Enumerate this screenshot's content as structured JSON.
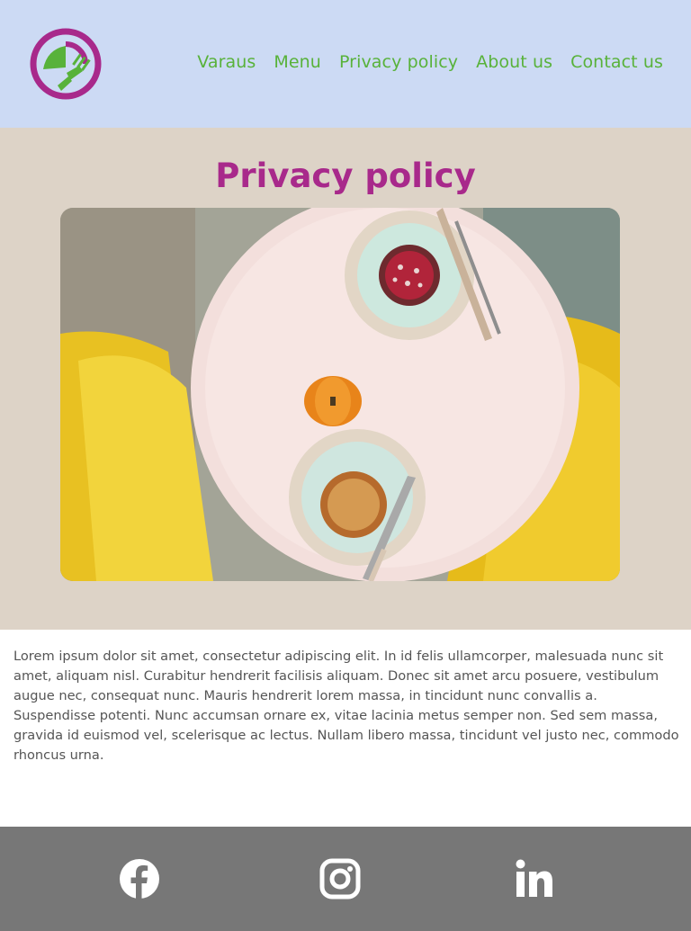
{
  "header": {
    "logo_name": "restaurant-logo",
    "nav": [
      {
        "label": "Varaus"
      },
      {
        "label": "Menu"
      },
      {
        "label": "Privacy policy"
      },
      {
        "label": "About us"
      },
      {
        "label": "Contact us"
      }
    ]
  },
  "hero": {
    "title": "Privacy policy",
    "image_subject": "table with desserts photo"
  },
  "content": {
    "body": "Lorem ipsum dolor sit amet, consectetur adipiscing elit. In id felis ullamcorper, malesuada nunc sit amet, aliquam nisl. Curabitur hendrerit facilisis aliquam. Donec sit amet arcu posuere, vestibulum augue nec, consequat nunc. Mauris hendrerit lorem massa, in tincidunt nunc convallis a. Suspendisse potenti. Nunc accumsan ornare ex, vitae lacinia metus semper non. Sed sem massa, gravida id euismod vel, scelerisque ac lectus. Nullam libero massa, tincidunt vel justo nec, commodo rhoncus urna."
  },
  "footer": {
    "social": [
      "facebook-icon",
      "instagram-icon",
      "linkedin-icon"
    ]
  },
  "colors": {
    "header_bg": "#ccdaf4",
    "nav_text": "#58b23a",
    "title": "#a8298b",
    "hero_bg": "#ddd3c7",
    "footer_bg": "#777777"
  }
}
